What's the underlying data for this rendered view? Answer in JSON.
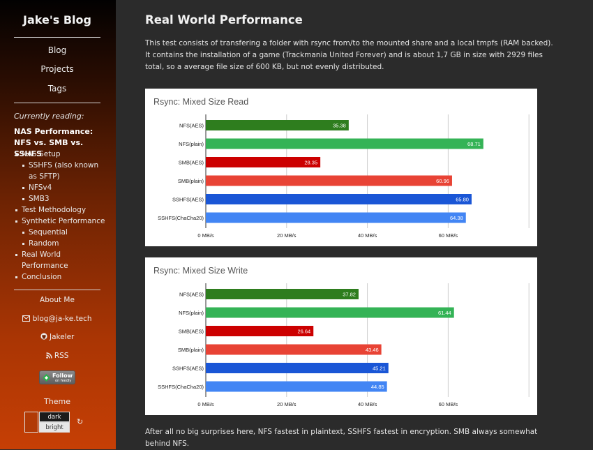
{
  "sidebar": {
    "blog_title": "Jake's Blog",
    "nav": [
      "Blog",
      "Projects",
      "Tags"
    ],
    "currently_reading_label": "Currently reading:",
    "current_article": "NAS Performance: NFS vs. SMB vs. SSHFS",
    "toc": [
      {
        "label": "NAS Setup",
        "level": 1
      },
      {
        "label": "SSHFS (also known as SFTP)",
        "level": 2
      },
      {
        "label": "NFSv4",
        "level": 2
      },
      {
        "label": "SMB3",
        "level": 2
      },
      {
        "label": "Test Methodology",
        "level": 1
      },
      {
        "label": "Synthetic Performance",
        "level": 1
      },
      {
        "label": "Sequential",
        "level": 2
      },
      {
        "label": "Random",
        "level": 2
      },
      {
        "label": "Real World Performance",
        "level": 1
      },
      {
        "label": "Conclusion",
        "level": 1
      }
    ],
    "about": "About Me",
    "email": "blog@ja-ke.tech",
    "github": "Jakeler",
    "rss": "RSS",
    "feedly_label": "Follow",
    "feedly_sub": "on feedly",
    "theme_label": "Theme",
    "theme_dark": "dark",
    "theme_bright": "bright",
    "icons": [
      "envelope-icon",
      "github-icon",
      "rss-icon",
      "feedly-icon",
      "reset-icon"
    ]
  },
  "main": {
    "title": "Real World Performance",
    "intro": "This test consists of transfering a folder with rsync from/to the mounted share and a local tmpfs (RAM backed). It contains the installation of a game (Trackmania United Forever) and is about 1,7 GB in size with 2929 files total, so a average file size of 600 KB, but not evenly distributed.",
    "conclusion": "After all no big surprises here, NFS fastest in plaintext, SSHFS fastest in encryption. SMB always somewhat behind NFS."
  },
  "colors": {
    "page_bg": "#2b2b2b",
    "nfs_aes": "#2e7d1e",
    "nfs_plain": "#34b356",
    "smb_aes": "#cc0000",
    "smb_plain": "#e84335",
    "sshfs_aes": "#1a56d6",
    "sshfs_chacha": "#4285f4"
  },
  "chart_data": [
    {
      "type": "bar",
      "orientation": "horizontal",
      "title": "Rsync: Mixed Size Read",
      "categories": [
        "NFS(AES)",
        "NFS(plain)",
        "SMB(AES)",
        "SMB(plain)",
        "SSHFS(AES)",
        "SSHFS(ChaCha20)"
      ],
      "values": [
        35.38,
        68.71,
        28.35,
        60.96,
        65.8,
        64.38
      ],
      "value_labels": [
        "35.38",
        "68.71",
        "28.35",
        "60.96",
        "65.80",
        "64.38"
      ],
      "xticks": [
        "0 MB/s",
        "20 MB/s",
        "40 MB/s",
        "60 MB/s"
      ],
      "xtick_values": [
        0,
        20,
        40,
        60
      ],
      "xlim": [
        0,
        80
      ],
      "grid": true
    },
    {
      "type": "bar",
      "orientation": "horizontal",
      "title": "Rsync: Mixed Size Write",
      "categories": [
        "NFS(AES)",
        "NFS(plain)",
        "SMB(AES)",
        "SMB(plain)",
        "SSHFS(AES)",
        "SSHFS(ChaCha20)"
      ],
      "values": [
        37.82,
        61.44,
        26.64,
        43.46,
        45.21,
        44.85
      ],
      "value_labels": [
        "37.82",
        "61.44",
        "26.64",
        "43.46",
        "45.21",
        "44.85"
      ],
      "xticks": [
        "0 MB/s",
        "20 MB/s",
        "40 MB/s",
        "60 MB/s"
      ],
      "xtick_values": [
        0,
        20,
        40,
        60
      ],
      "xlim": [
        0,
        80
      ],
      "grid": true
    }
  ]
}
